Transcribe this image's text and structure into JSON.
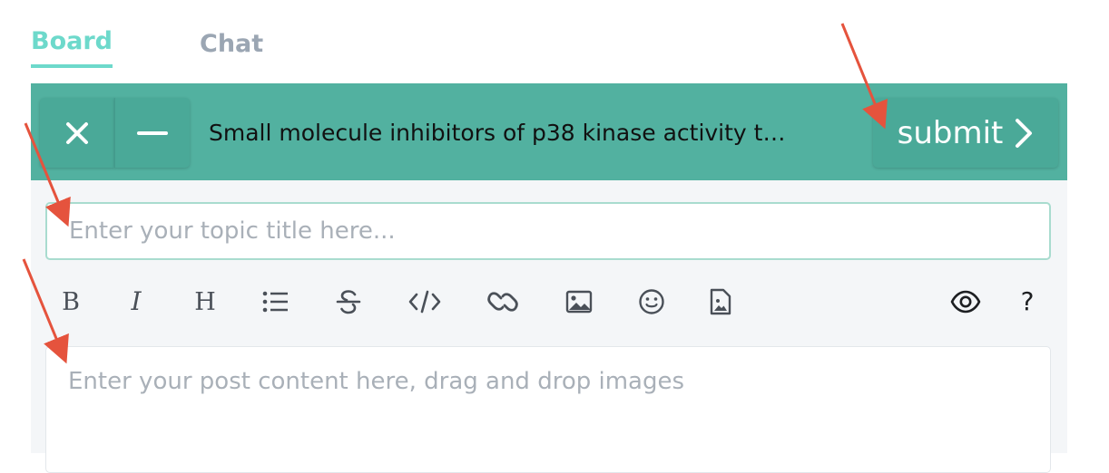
{
  "tabs": [
    {
      "label": "Board",
      "active": true
    },
    {
      "label": "Chat",
      "active": false
    }
  ],
  "composer": {
    "close_icon": "close-icon",
    "minimize_icon": "minimize-icon",
    "title_text": "Small molecule inhibitors of p38 kinase activity t…",
    "submit_label": "submit",
    "submit_icon": "chevron-right-icon"
  },
  "title_input": {
    "value": "",
    "placeholder": "Enter your topic title here..."
  },
  "toolbar": {
    "tools": [
      "bold-icon",
      "italic-icon",
      "heading-icon",
      "list-icon",
      "strikethrough-icon",
      "code-icon",
      "link-icon",
      "image-icon",
      "emoji-icon",
      "file-image-icon",
      "preview-eye-icon",
      "help-icon"
    ],
    "help_label": "?"
  },
  "content": {
    "placeholder": "Enter your post content here, drag and drop images"
  },
  "colors": {
    "accent": "#6dd9cb",
    "bar": "#52b1a0",
    "bar_button": "#4aa998",
    "annotation_arrow": "#e5533d"
  }
}
